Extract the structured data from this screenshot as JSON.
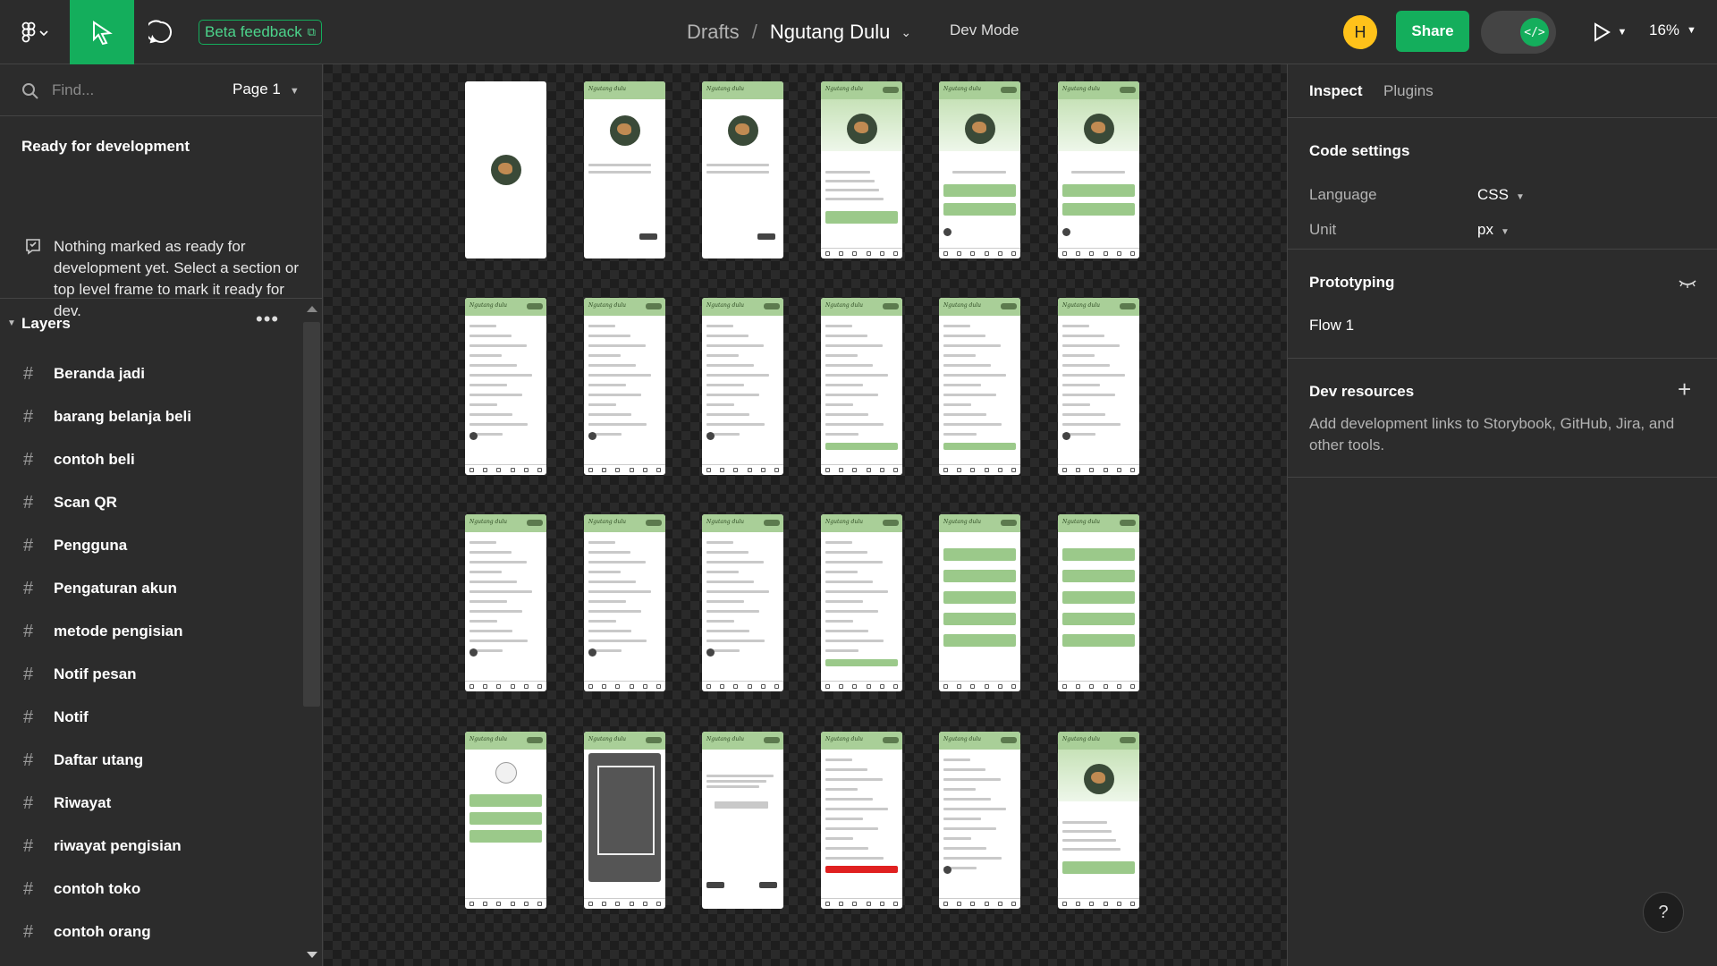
{
  "toolbar": {
    "beta_label": "Beta feedback",
    "breadcrumb_drafts": "Drafts",
    "breadcrumb_sep": "/",
    "file_name": "Ngutang Dulu",
    "dev_mode_label": "Dev Mode",
    "avatar_initial": "H",
    "share_label": "Share",
    "zoom": "16%",
    "accent_color": "#14ae5c"
  },
  "left": {
    "search_placeholder": "Find...",
    "page_label": "Page 1",
    "ready_title": "Ready for development",
    "ready_text": "Nothing marked as ready for development yet. Select a section or top level frame to mark it ready for dev.",
    "layers_title": "Layers",
    "layers": [
      "Beranda jadi",
      "barang belanja beli",
      "contoh beli",
      "Scan QR",
      "Pengguna",
      "Pengaturan akun",
      "metode pengisian",
      "Notif pesan",
      "Notif",
      "Daftar utang",
      "Riwayat",
      "riwayat pengisian",
      "contoh toko",
      "contoh orang"
    ]
  },
  "canvas": {
    "brand": "Ngutang dulu"
  },
  "right": {
    "tab_inspect": "Inspect",
    "tab_plugins": "Plugins",
    "code_settings_title": "Code settings",
    "language_label": "Language",
    "language_value": "CSS",
    "unit_label": "Unit",
    "unit_value": "px",
    "prototyping_title": "Prototyping",
    "flow_label": "Flow 1",
    "dev_resources_title": "Dev resources",
    "dev_resources_text": "Add development links to Storybook, GitHub, Jira, and other tools.",
    "help_label": "?"
  }
}
